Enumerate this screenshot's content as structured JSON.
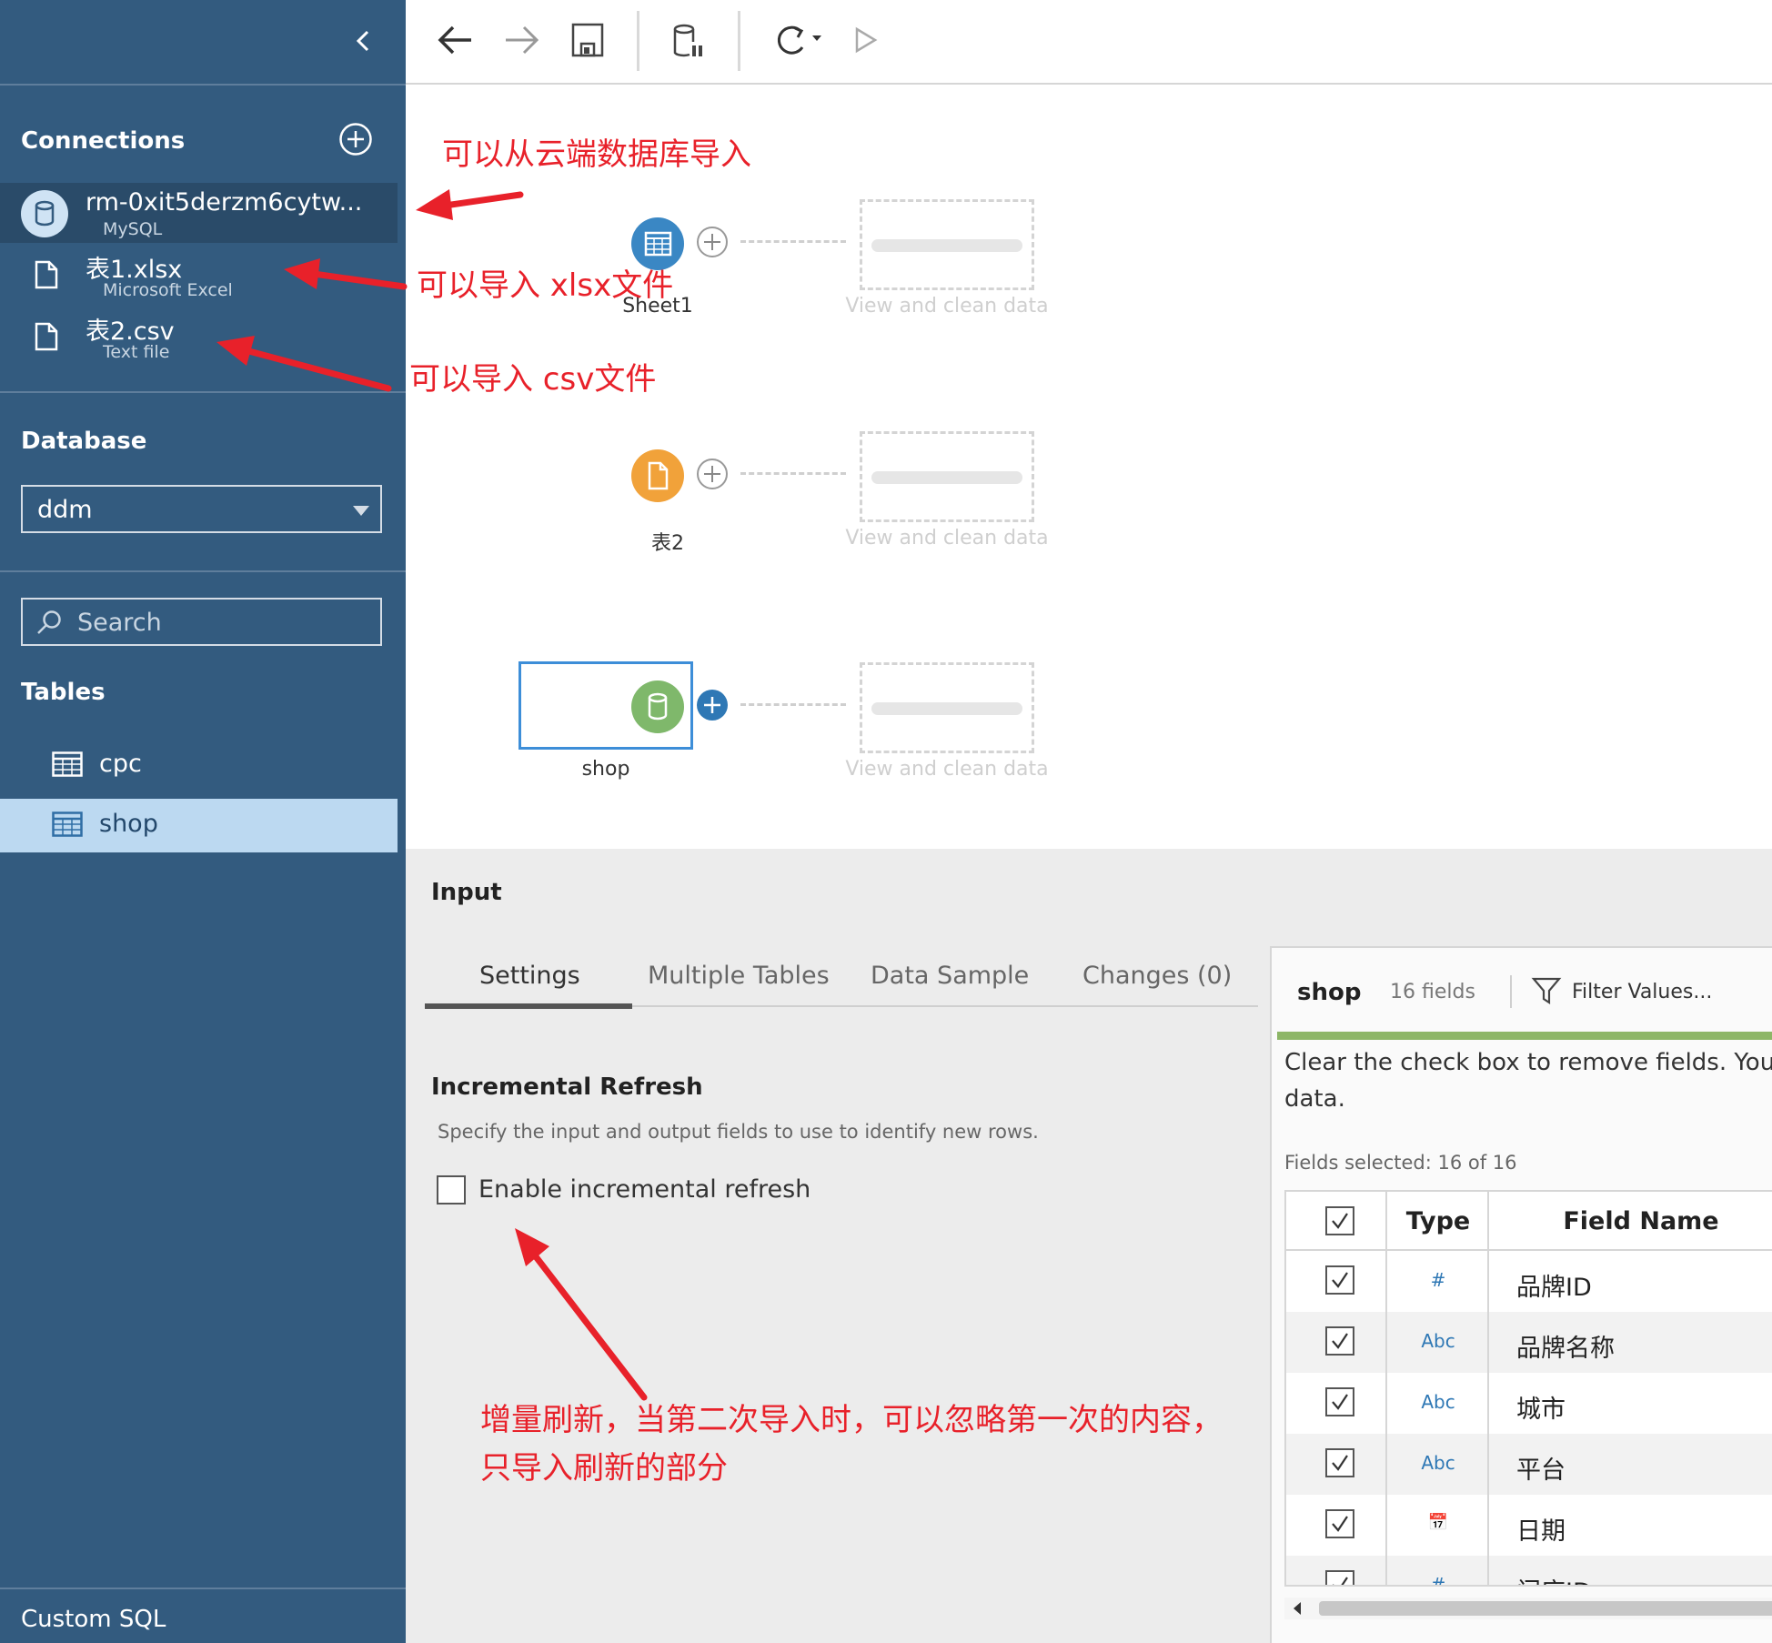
{
  "sidebar": {
    "connections_heading": "Connections",
    "connections": [
      {
        "name": "rm-0xit5derzm6cytw...",
        "type": "MySQL"
      },
      {
        "name": "表1.xlsx",
        "type": "Microsoft Excel"
      },
      {
        "name": "表2.csv",
        "type": "Text file"
      }
    ],
    "database_heading": "Database",
    "database_value": "ddm",
    "search_placeholder": "Search",
    "tables_heading": "Tables",
    "tables": [
      "cpc",
      "shop"
    ],
    "custom_sql": "Custom SQL"
  },
  "canvas": {
    "nodes": [
      {
        "label": "Sheet1",
        "placeholder": "View and clean data",
        "color": "#3a87c4"
      },
      {
        "label": "表2",
        "placeholder": "View and clean data",
        "color": "#f1a23a"
      },
      {
        "label": "shop",
        "placeholder": "View and clean data",
        "color": "#7fb86b"
      }
    ]
  },
  "input_pane": {
    "title": "Input",
    "tabs": [
      "Settings",
      "Multiple Tables",
      "Data Sample",
      "Changes (0)"
    ],
    "active_tab": "Settings",
    "incremental_title": "Incremental Refresh",
    "incremental_desc": "Specify the input and output fields to use to identify new rows.",
    "incremental_checkbox": "Enable incremental refresh",
    "incremental_checked": false
  },
  "field_panel": {
    "table_name": "shop",
    "field_count": "16 fields",
    "filter_label": "Filter Values...",
    "description_line1": "Clear the check box to remove fields. You ca",
    "description_line2": "data.",
    "fields_selected": "Fields selected: 16 of 16",
    "header_type": "Type",
    "header_name": "Field Name",
    "fields": [
      {
        "type": "#",
        "type_icon": "number-icon",
        "name": "品牌ID"
      },
      {
        "type": "Abc",
        "type_icon": "string-icon",
        "name": "品牌名称"
      },
      {
        "type": "Abc",
        "type_icon": "string-icon",
        "name": "城市"
      },
      {
        "type": "Abc",
        "type_icon": "string-icon",
        "name": "平台"
      },
      {
        "type": "📅",
        "type_icon": "date-icon",
        "name": "日期"
      },
      {
        "type": "#",
        "type_icon": "number-icon",
        "name": "门店ID"
      }
    ]
  },
  "annotations": {
    "cloud_db": "可以从云端数据库导入",
    "xlsx": "可以导入 xlsx文件",
    "csv": "可以导入 csv文件",
    "incremental_line1": "增量刷新，当第二次导入时，可以忽略第一次的内容，",
    "incremental_line2": "只导入刷新的部分",
    "color": "#e8212a"
  }
}
